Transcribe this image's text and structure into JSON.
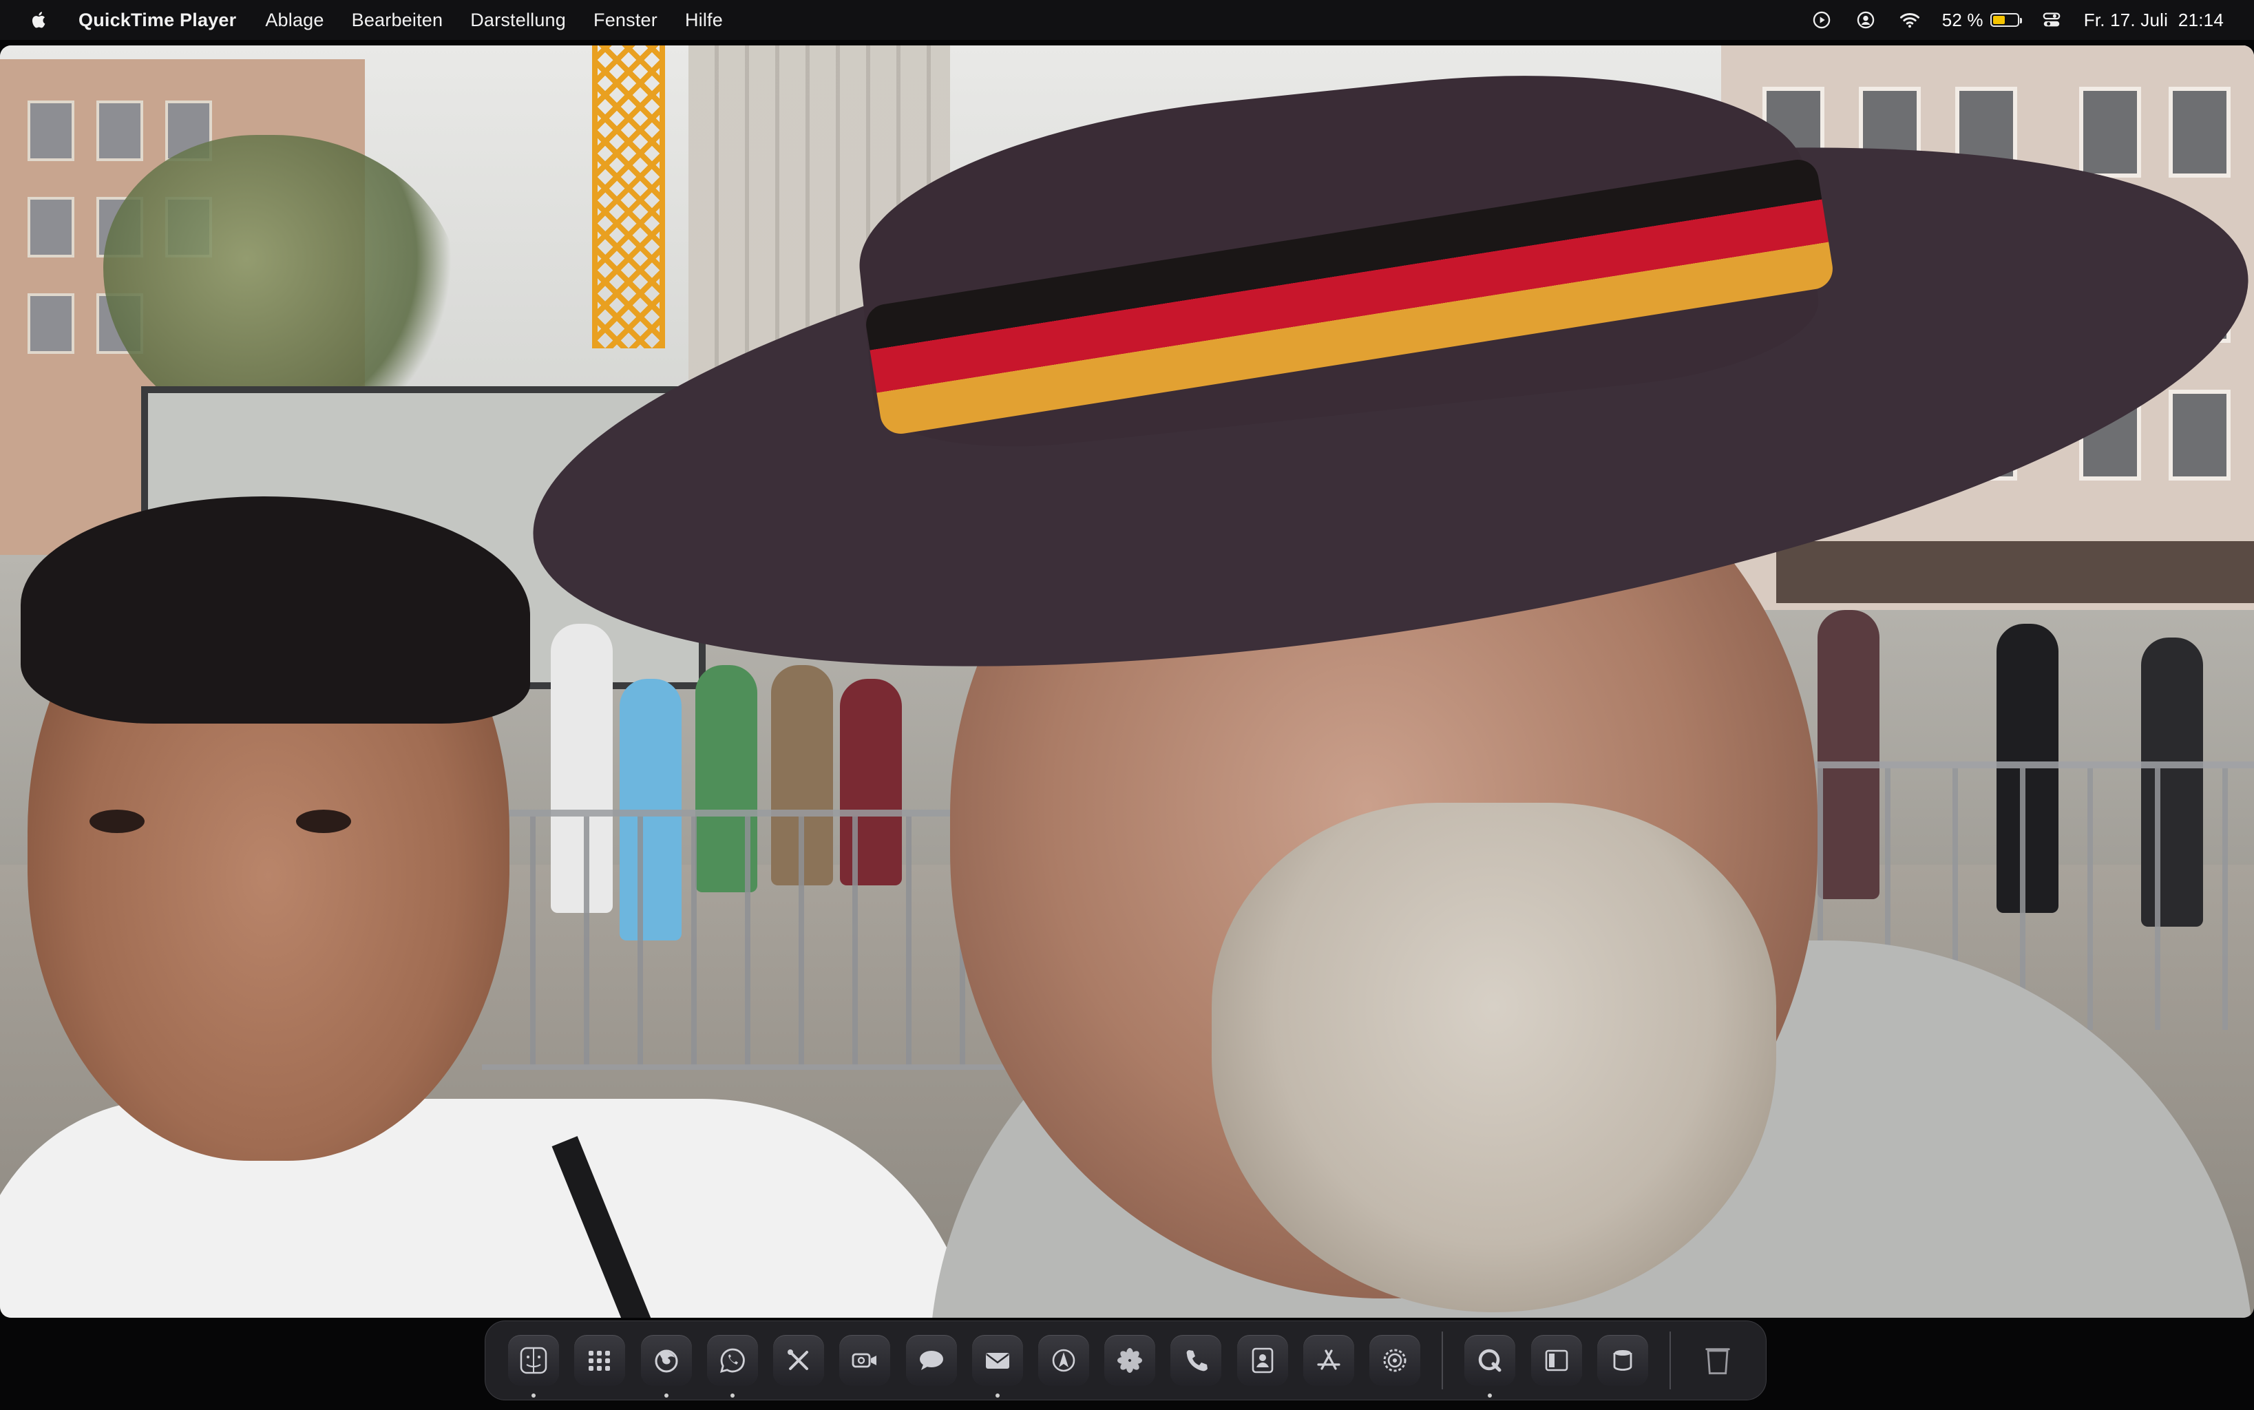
{
  "menubar": {
    "app_name": "QuickTime Player",
    "menus": [
      "Ablage",
      "Bearbeiten",
      "Darstellung",
      "Fenster",
      "Hilfe"
    ],
    "battery_percent": "52 %",
    "battery_level": 0.52,
    "datetime": "Fr. 17. Juli  21:14"
  },
  "status_icons": [
    "play-circle-icon",
    "user-circle-icon",
    "wifi-icon",
    "battery-icon",
    "control-center-icon"
  ],
  "video": {
    "description_only_visual": true
  },
  "dock": {
    "apps": [
      {
        "name": "finder-icon",
        "running": true
      },
      {
        "name": "launchpad-icon",
        "running": false
      },
      {
        "name": "firefox-icon",
        "running": true
      },
      {
        "name": "whatsapp-icon",
        "running": true
      },
      {
        "name": "tools-icon",
        "running": false
      },
      {
        "name": "facetime-icon",
        "running": false
      },
      {
        "name": "messages-icon",
        "running": false
      },
      {
        "name": "mail-icon",
        "running": true
      },
      {
        "name": "maps-icon",
        "running": false
      },
      {
        "name": "photos-icon",
        "running": false
      },
      {
        "name": "phone-icon",
        "running": false
      },
      {
        "name": "contacts-icon",
        "running": false
      },
      {
        "name": "app-store-icon",
        "running": false
      },
      {
        "name": "system-settings-icon",
        "running": false
      }
    ],
    "apps_right": [
      {
        "name": "quicktime-icon",
        "running": true
      },
      {
        "name": "preview-icon",
        "running": false
      },
      {
        "name": "disk-utility-icon",
        "running": false
      }
    ],
    "trash": {
      "name": "trash-icon"
    }
  }
}
